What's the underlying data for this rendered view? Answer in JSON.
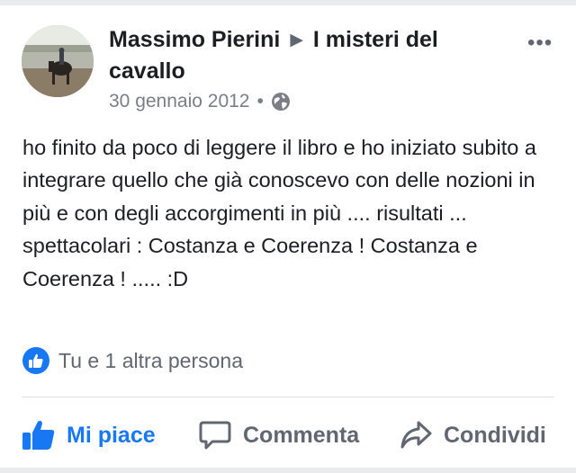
{
  "post": {
    "author": "Massimo Pierini",
    "group": "I misteri del cavallo",
    "date": "30 gennaio 2012",
    "separator": "•",
    "privacy_icon": "globe-icon",
    "more_icon": "more-options-icon",
    "text": "ho finito da poco di leggere il libro e ho iniziato subito a integrare quello che già conoscevo con delle nozioni in più e con degli accorgimenti in più .... risultati ... spettacolari : Costanza e Coerenza ! Costanza e Coerenza ! ..... :D"
  },
  "reactions": {
    "icon": "like-badge-icon",
    "text": "Tu e 1 altra persona"
  },
  "actions": {
    "like_label": "Mi piace",
    "comment_label": "Commenta",
    "share_label": "Condividi"
  },
  "colors": {
    "accent": "#1877f2",
    "muted": "#606770",
    "text": "#1c1e21",
    "frame": "#e9ebee"
  }
}
